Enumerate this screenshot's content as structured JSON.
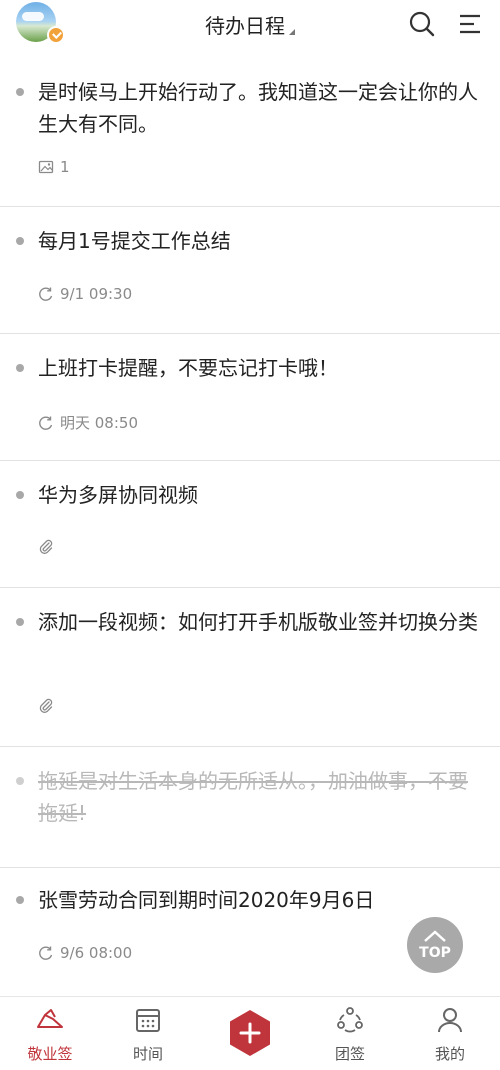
{
  "header": {
    "title": "待办日程"
  },
  "items": [
    {
      "text": "是时候马上开始行动了。我知道这一定会让你的人生大有不同。",
      "meta_icon": "image-icon",
      "meta_text": "1",
      "completed": false
    },
    {
      "text": "每月1号提交工作总结",
      "meta_icon": "repeat-clock-icon",
      "meta_text": "9/1 09:30",
      "completed": false
    },
    {
      "text": "上班打卡提醒，不要忘记打卡哦！",
      "meta_icon": "repeat-clock-icon",
      "meta_text": "明天 08:50",
      "completed": false
    },
    {
      "text": "华为多屏协同视频",
      "meta_icon": "attachment-icon",
      "meta_text": "",
      "completed": false
    },
    {
      "text": "添加一段视频：如何打开手机版敬业签并切换分类",
      "meta_icon": "attachment-icon",
      "meta_text": "",
      "completed": false
    },
    {
      "text": "拖延是对生活本身的无所适从。，加油做事，不要拖延!",
      "meta_icon": "",
      "meta_text": "",
      "completed": true
    },
    {
      "text": "张雪劳动合同到期时间2020年9月6日",
      "meta_icon": "repeat-clock-icon",
      "meta_text": "9/6 08:00",
      "completed": false
    }
  ],
  "top_button": {
    "label": "TOP"
  },
  "nav": {
    "items": [
      {
        "label": "敬业签",
        "icon": "notes-icon",
        "active": true
      },
      {
        "label": "时间",
        "icon": "calendar-icon",
        "active": false
      },
      {
        "label": "",
        "icon": "add-icon",
        "active": false
      },
      {
        "label": "团签",
        "icon": "team-icon",
        "active": false
      },
      {
        "label": "我的",
        "icon": "profile-icon",
        "active": false
      }
    ]
  },
  "colors": {
    "accent": "#c0343b",
    "dot": "#a8a8a8",
    "meta": "#8a8a8a",
    "divider": "#e2e2e2"
  }
}
